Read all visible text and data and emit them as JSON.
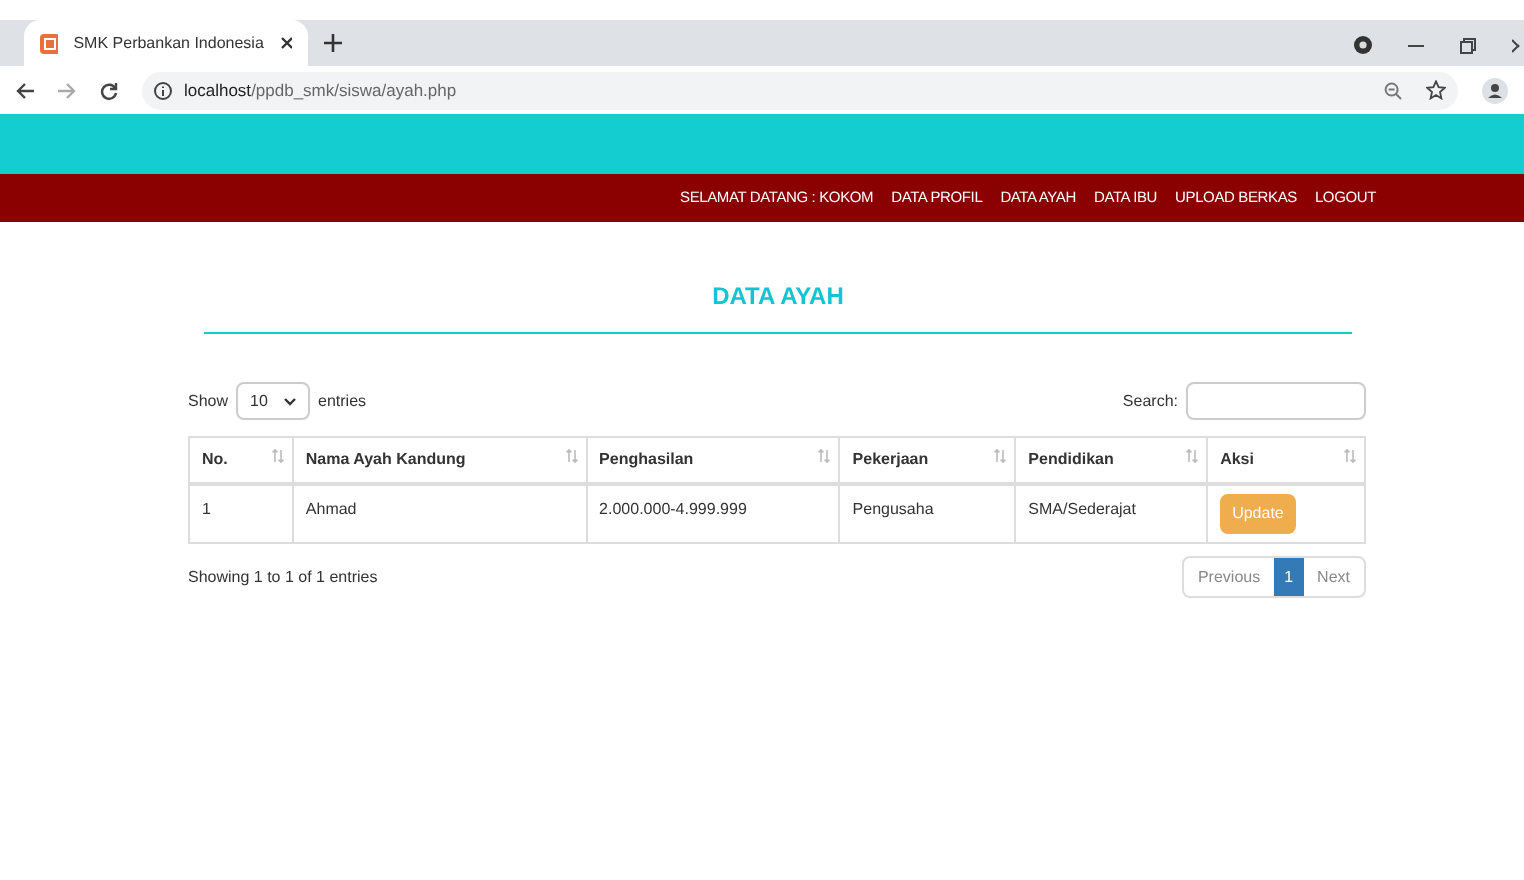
{
  "browser": {
    "tab_title": "SMK Perbankan Indonesia",
    "url_host": "localhost",
    "url_path": "/ppdb_smk/siswa/ayah.php"
  },
  "nav": {
    "items": [
      "SELAMAT DATANG : KOKOM",
      "DATA PROFIL",
      "DATA AYAH",
      "DATA IBU",
      "UPLOAD BERKAS",
      "LOGOUT"
    ]
  },
  "page_title": "DATA AYAH",
  "length": {
    "before": "Show",
    "value": "10",
    "after": "entries"
  },
  "search": {
    "label": "Search:"
  },
  "table": {
    "columns": [
      "No.",
      "Nama Ayah Kandung",
      "Penghasilan",
      "Pekerjaan",
      "Pendidikan",
      "Aksi"
    ],
    "rows": [
      {
        "cells": [
          "1",
          "Ahmad",
          "2.000.000-4.999.999",
          "Pengusaha",
          "SMA/Sederajat"
        ],
        "action": "Update"
      }
    ]
  },
  "info": "Showing 1 to 1 of 1 entries",
  "pagination": [
    {
      "label": "Previous",
      "selected": false
    },
    {
      "label": "1",
      "selected": true
    },
    {
      "label": "Next",
      "selected": false
    }
  ]
}
